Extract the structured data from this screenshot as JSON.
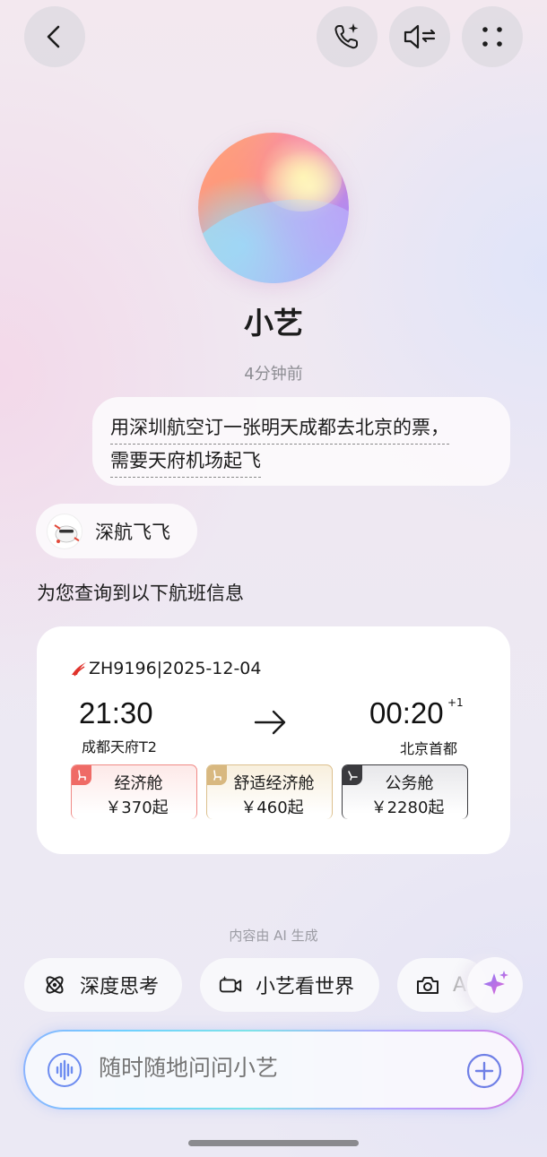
{
  "header": {
    "back_icon": "chevron-left-icon",
    "call_icon": "phone-sparkle-icon",
    "speaker_icon": "speaker-settings-icon",
    "menu_icon": "four-dots-icon"
  },
  "assistant": {
    "name": "小艺",
    "timestamp": "4分钟前"
  },
  "user_message": {
    "line1": "用深圳航空订一张明天成都去北京的票，",
    "line2": "需要天府机场起飞"
  },
  "agent": {
    "name": "深航飞飞"
  },
  "reply_text": "为您查询到以下航班信息",
  "flight": {
    "number_date": "ZH9196|2025-12-04",
    "depart_time": "21:30",
    "arrive_time": "00:20",
    "day_offset": "+1",
    "depart_airport": "成都天府T2",
    "arrive_airport": "北京首都",
    "fares": [
      {
        "class": "经济舱",
        "price": "￥370起",
        "color": "#ef6b66"
      },
      {
        "class": "舒适经济舱",
        "price": "￥460起",
        "color": "#d8b880"
      },
      {
        "class": "公务舱",
        "price": "￥2280起",
        "color": "#3a3a3e"
      }
    ]
  },
  "ai_note": "内容由 AI 生成",
  "quick_actions": [
    {
      "label": "深度思考",
      "icon": "atom-icon"
    },
    {
      "label": "小艺看世界",
      "icon": "video-camera-icon"
    },
    {
      "label": "A",
      "icon": "camera-icon"
    }
  ],
  "input": {
    "placeholder": "随时随地问问小艺"
  },
  "colors": {
    "accent_gradient_start": "#8ab4ff",
    "accent_gradient_end": "#d27fe6",
    "sparkle": "#c86ae8"
  }
}
